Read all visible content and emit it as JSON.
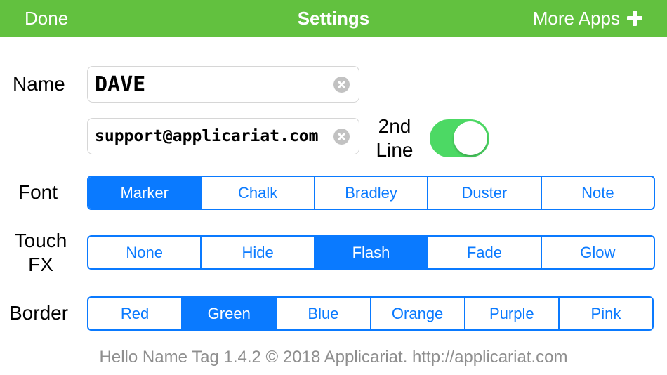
{
  "colors": {
    "accent": "#62c13f",
    "tint": "#0a7aff",
    "toggle_on": "#4cd964"
  },
  "navbar": {
    "done_label": "Done",
    "title": "Settings",
    "more_label": "More Apps",
    "more_icon": "plus-icon"
  },
  "name_label": "Name",
  "name_field": {
    "value": "DAVE"
  },
  "second_line_field": {
    "value": "support@applicariat.com"
  },
  "second_line_toggle": {
    "label_line1": "2nd",
    "label_line2": "Line",
    "on": true
  },
  "font": {
    "label": "Font",
    "options": [
      "Marker",
      "Chalk",
      "Bradley",
      "Duster",
      "Note"
    ],
    "selected": "Marker"
  },
  "touch_fx": {
    "label_line1": "Touch",
    "label_line2": "FX",
    "options": [
      "None",
      "Hide",
      "Flash",
      "Fade",
      "Glow"
    ],
    "selected": "Flash"
  },
  "border": {
    "label": "Border",
    "options": [
      "Red",
      "Green",
      "Blue",
      "Orange",
      "Purple",
      "Pink"
    ],
    "selected": "Green"
  },
  "footer": {
    "text": "Hello Name Tag 1.4.2 © 2018 Applicariat. http://applicariat.com"
  }
}
